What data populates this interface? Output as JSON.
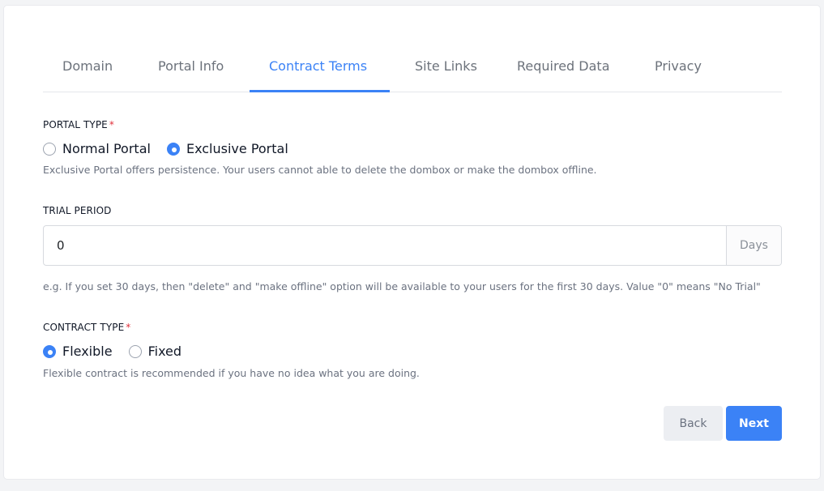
{
  "tabs": [
    {
      "label": "Domain",
      "active": false
    },
    {
      "label": "Portal Info",
      "active": false
    },
    {
      "label": "Contract Terms",
      "active": true
    },
    {
      "label": "Site Links",
      "active": false
    },
    {
      "label": "Required Data",
      "active": false
    },
    {
      "label": "Privacy",
      "active": false
    }
  ],
  "portal_type": {
    "label": "PORTAL TYPE",
    "required_mark": "*",
    "options": [
      {
        "label": "Normal Portal",
        "checked": false
      },
      {
        "label": "Exclusive Portal",
        "checked": true
      }
    ],
    "help": "Exclusive Portal offers persistence. Your users cannot able to delete the dombox or make the dombox offline."
  },
  "trial_period": {
    "label": "TRIAL PERIOD",
    "value": "0",
    "addon": "Days",
    "help": "e.g. If you set 30 days, then \"delete\" and \"make offline\" option will be available to your users for the first 30 days. Value \"0\" means \"No Trial\""
  },
  "contract_type": {
    "label": "CONTRACT TYPE",
    "required_mark": "*",
    "options": [
      {
        "label": "Flexible",
        "checked": true
      },
      {
        "label": "Fixed",
        "checked": false
      }
    ],
    "help": "Flexible contract is recommended if you have no idea what you are doing."
  },
  "actions": {
    "back_label": "Back",
    "next_label": "Next"
  },
  "colors": {
    "accent": "#3b82f6",
    "required": "#e0313b"
  }
}
